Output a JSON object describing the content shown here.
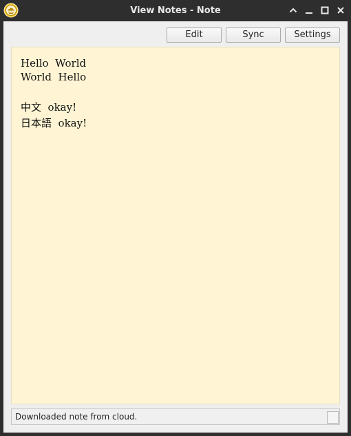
{
  "window": {
    "title": "View Notes - Note",
    "app_icon": "cloud-note-icon",
    "controls": [
      "chevron-up-icon",
      "minimize-icon",
      "maximize-icon",
      "close-icon"
    ]
  },
  "toolbar": {
    "edit_label": "Edit",
    "sync_label": "Sync",
    "settings_label": "Settings"
  },
  "note": {
    "lines": [
      "Hello  World",
      "World  Hello",
      "",
      "中文  okay!",
      "日本語  okay!"
    ]
  },
  "status": {
    "text": "Downloaded note from cloud."
  },
  "colors": {
    "titlebar": "#2e2e2e",
    "note_background": "#fff5d4",
    "icon_accent": "#f0c020"
  }
}
